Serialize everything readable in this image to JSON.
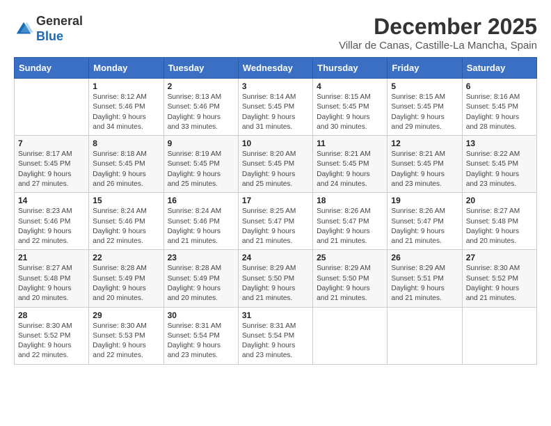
{
  "logo": {
    "general": "General",
    "blue": "Blue"
  },
  "header": {
    "month": "December 2025",
    "location": "Villar de Canas, Castille-La Mancha, Spain"
  },
  "weekdays": [
    "Sunday",
    "Monday",
    "Tuesday",
    "Wednesday",
    "Thursday",
    "Friday",
    "Saturday"
  ],
  "weeks": [
    [
      {
        "day": "",
        "info": ""
      },
      {
        "day": "1",
        "info": "Sunrise: 8:12 AM\nSunset: 5:46 PM\nDaylight: 9 hours\nand 34 minutes."
      },
      {
        "day": "2",
        "info": "Sunrise: 8:13 AM\nSunset: 5:46 PM\nDaylight: 9 hours\nand 33 minutes."
      },
      {
        "day": "3",
        "info": "Sunrise: 8:14 AM\nSunset: 5:45 PM\nDaylight: 9 hours\nand 31 minutes."
      },
      {
        "day": "4",
        "info": "Sunrise: 8:15 AM\nSunset: 5:45 PM\nDaylight: 9 hours\nand 30 minutes."
      },
      {
        "day": "5",
        "info": "Sunrise: 8:15 AM\nSunset: 5:45 PM\nDaylight: 9 hours\nand 29 minutes."
      },
      {
        "day": "6",
        "info": "Sunrise: 8:16 AM\nSunset: 5:45 PM\nDaylight: 9 hours\nand 28 minutes."
      }
    ],
    [
      {
        "day": "7",
        "info": "Sunrise: 8:17 AM\nSunset: 5:45 PM\nDaylight: 9 hours\nand 27 minutes."
      },
      {
        "day": "8",
        "info": "Sunrise: 8:18 AM\nSunset: 5:45 PM\nDaylight: 9 hours\nand 26 minutes."
      },
      {
        "day": "9",
        "info": "Sunrise: 8:19 AM\nSunset: 5:45 PM\nDaylight: 9 hours\nand 25 minutes."
      },
      {
        "day": "10",
        "info": "Sunrise: 8:20 AM\nSunset: 5:45 PM\nDaylight: 9 hours\nand 25 minutes."
      },
      {
        "day": "11",
        "info": "Sunrise: 8:21 AM\nSunset: 5:45 PM\nDaylight: 9 hours\nand 24 minutes."
      },
      {
        "day": "12",
        "info": "Sunrise: 8:21 AM\nSunset: 5:45 PM\nDaylight: 9 hours\nand 23 minutes."
      },
      {
        "day": "13",
        "info": "Sunrise: 8:22 AM\nSunset: 5:45 PM\nDaylight: 9 hours\nand 23 minutes."
      }
    ],
    [
      {
        "day": "14",
        "info": "Sunrise: 8:23 AM\nSunset: 5:46 PM\nDaylight: 9 hours\nand 22 minutes."
      },
      {
        "day": "15",
        "info": "Sunrise: 8:24 AM\nSunset: 5:46 PM\nDaylight: 9 hours\nand 22 minutes."
      },
      {
        "day": "16",
        "info": "Sunrise: 8:24 AM\nSunset: 5:46 PM\nDaylight: 9 hours\nand 21 minutes."
      },
      {
        "day": "17",
        "info": "Sunrise: 8:25 AM\nSunset: 5:47 PM\nDaylight: 9 hours\nand 21 minutes."
      },
      {
        "day": "18",
        "info": "Sunrise: 8:26 AM\nSunset: 5:47 PM\nDaylight: 9 hours\nand 21 minutes."
      },
      {
        "day": "19",
        "info": "Sunrise: 8:26 AM\nSunset: 5:47 PM\nDaylight: 9 hours\nand 21 minutes."
      },
      {
        "day": "20",
        "info": "Sunrise: 8:27 AM\nSunset: 5:48 PM\nDaylight: 9 hours\nand 20 minutes."
      }
    ],
    [
      {
        "day": "21",
        "info": "Sunrise: 8:27 AM\nSunset: 5:48 PM\nDaylight: 9 hours\nand 20 minutes."
      },
      {
        "day": "22",
        "info": "Sunrise: 8:28 AM\nSunset: 5:49 PM\nDaylight: 9 hours\nand 20 minutes."
      },
      {
        "day": "23",
        "info": "Sunrise: 8:28 AM\nSunset: 5:49 PM\nDaylight: 9 hours\nand 20 minutes."
      },
      {
        "day": "24",
        "info": "Sunrise: 8:29 AM\nSunset: 5:50 PM\nDaylight: 9 hours\nand 21 minutes."
      },
      {
        "day": "25",
        "info": "Sunrise: 8:29 AM\nSunset: 5:50 PM\nDaylight: 9 hours\nand 21 minutes."
      },
      {
        "day": "26",
        "info": "Sunrise: 8:29 AM\nSunset: 5:51 PM\nDaylight: 9 hours\nand 21 minutes."
      },
      {
        "day": "27",
        "info": "Sunrise: 8:30 AM\nSunset: 5:52 PM\nDaylight: 9 hours\nand 21 minutes."
      }
    ],
    [
      {
        "day": "28",
        "info": "Sunrise: 8:30 AM\nSunset: 5:52 PM\nDaylight: 9 hours\nand 22 minutes."
      },
      {
        "day": "29",
        "info": "Sunrise: 8:30 AM\nSunset: 5:53 PM\nDaylight: 9 hours\nand 22 minutes."
      },
      {
        "day": "30",
        "info": "Sunrise: 8:31 AM\nSunset: 5:54 PM\nDaylight: 9 hours\nand 23 minutes."
      },
      {
        "day": "31",
        "info": "Sunrise: 8:31 AM\nSunset: 5:54 PM\nDaylight: 9 hours\nand 23 minutes."
      },
      {
        "day": "",
        "info": ""
      },
      {
        "day": "",
        "info": ""
      },
      {
        "day": "",
        "info": ""
      }
    ]
  ]
}
